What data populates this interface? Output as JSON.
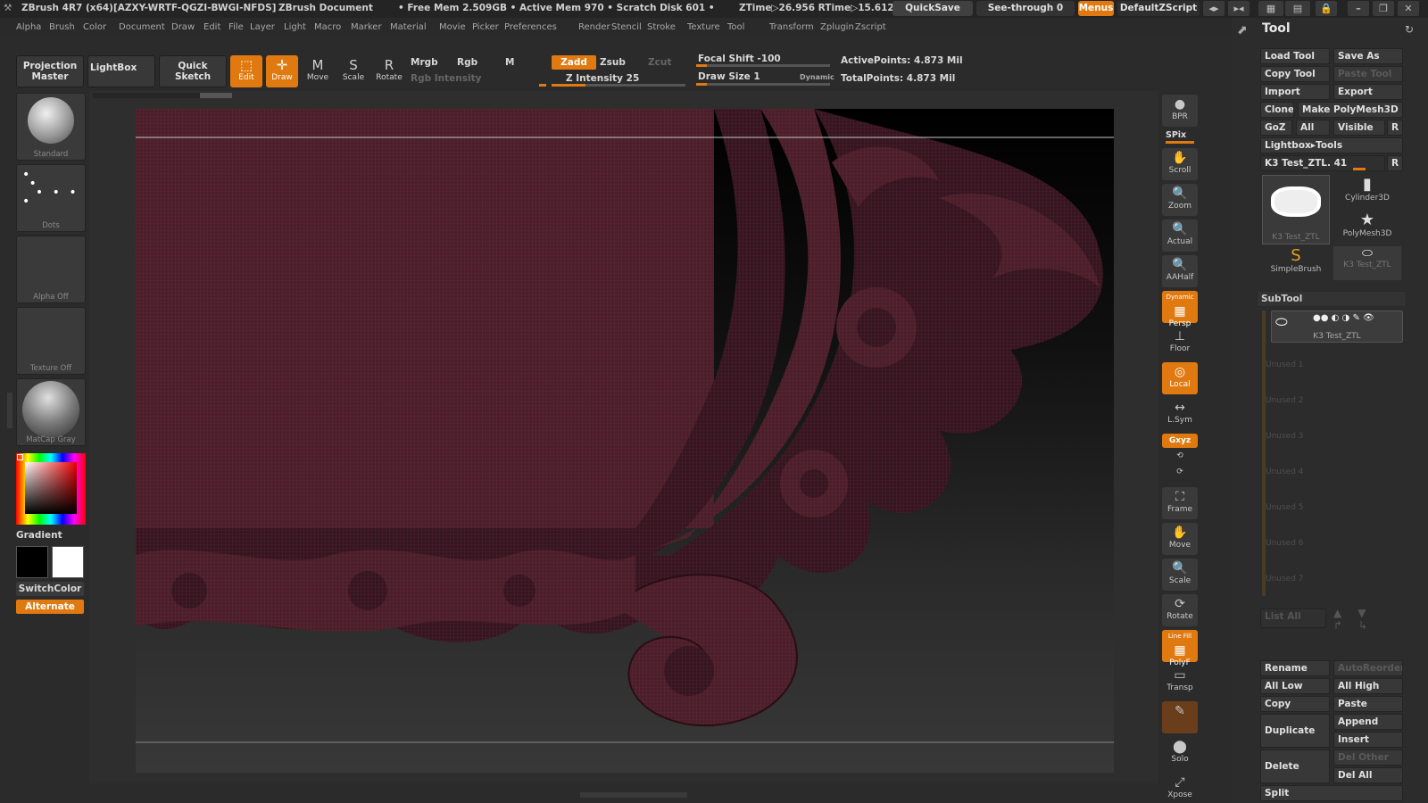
{
  "titlebar": {
    "app": "ZBrush 4R7 (x64)[AZXY-WRTF-QGZI-BWGI-NFDS]",
    "doc": "ZBrush Document",
    "stats": "• Free Mem 2.509GB • Active Mem 970 • Scratch Disk 601 •",
    "ztime": "ZTime▷26.956 RTime▷15.612",
    "quicksave": "QuickSave",
    "seethrough": "See-through   0",
    "menus": "Menus",
    "script": "DefaultZScript"
  },
  "menu": [
    "Alpha",
    "Brush",
    "Color",
    "Document",
    "Draw",
    "Edit",
    "File",
    "Layer",
    "Light",
    "Macro",
    "Marker",
    "Material",
    "Movie",
    "Picker",
    "Preferences",
    "Render",
    "Stencil",
    "Stroke",
    "Texture",
    "Tool",
    "Transform",
    "Zplugin",
    "Zscript"
  ],
  "toolbar": {
    "projection_master": "Projection Master",
    "lightbox": "LightBox",
    "quick_sketch": "Quick Sketch",
    "edit": "Edit",
    "draw": "Draw",
    "move": "Move",
    "scale": "Scale",
    "rotate": "Rotate",
    "mrgb": "Mrgb",
    "rgb": "Rgb",
    "m": "M",
    "rgb_intensity": "Rgb Intensity",
    "zadd": "Zadd",
    "zsub": "Zsub",
    "zcut": "Zcut",
    "z_intensity": "Z Intensity 25",
    "focal_shift": "Focal Shift -100",
    "draw_size": "Draw Size 1",
    "dynamic": "Dynamic",
    "active_points": "ActivePoints: 4.873  Mil",
    "total_points": "TotalPoints: 4.873  Mil",
    "z_intensity_value": 25,
    "z_intensity_max": 100
  },
  "leftshelf": {
    "standard": "Standard",
    "dots": "Dots",
    "alpha": "Alpha  Off",
    "texture": "Texture  Off",
    "matcap": "MatCap  Gray",
    "gradient": "Gradient",
    "switchcolor": "SwitchColor",
    "alternate": "Alternate"
  },
  "rightshelf": {
    "bpr": "BPR",
    "spix": "SPix",
    "scroll": "Scroll",
    "zoom": "Zoom",
    "actual": "Actual",
    "aahalf": "AAHalf",
    "persp": "Persp",
    "floor": "Floor",
    "local": "Local",
    "lsym": "L.Sym",
    "xyz": "Gxyz",
    "frame": "Frame",
    "move": "Move",
    "scale": "Scale",
    "rotate": "Rotate",
    "polyf": "PolyF",
    "transp": "Transp",
    "solo": "Solo",
    "xpose": "Xpose",
    "dynamic": "Dynamic",
    "linefill": "Line Fill"
  },
  "tool": {
    "title": "Tool",
    "load_tool": "Load Tool",
    "save_as": "Save As",
    "copy_tool": "Copy Tool",
    "paste_tool": "Paste Tool",
    "import": "Import",
    "export": "Export",
    "clone": "Clone",
    "make_polymesh": "Make PolyMesh3D",
    "goz": "GoZ",
    "all": "All",
    "visible": "Visible",
    "r": "R",
    "lightbox_tools": "Lightbox▸Tools",
    "current_tool": "K3 Test_ZTL. 41",
    "thumbs": [
      "K3 Test_ZTL",
      "Cylinder3D",
      "PolyMesh3D",
      "SimpleBrush",
      "K3 Test_ZTL"
    ]
  },
  "subtool": {
    "title": "SubTool",
    "active": "K3 Test_ZTL",
    "slots": [
      "Unused 1",
      "Unused 2",
      "Unused 3",
      "Unused 4",
      "Unused 5",
      "Unused 6",
      "Unused 7"
    ],
    "list_all": "List  All",
    "rename": "Rename",
    "autoreorder": "AutoReorder",
    "all_low": "All Low",
    "all_high": "All High",
    "copy": "Copy",
    "paste": "Paste",
    "duplicate": "Duplicate",
    "append": "Append",
    "insert": "Insert",
    "delete": "Delete",
    "del_other": "Del Other",
    "del_all": "Del All",
    "split": "Split"
  },
  "colors": {
    "accent": "#e07a10",
    "mesh": "#4a1e2a"
  }
}
